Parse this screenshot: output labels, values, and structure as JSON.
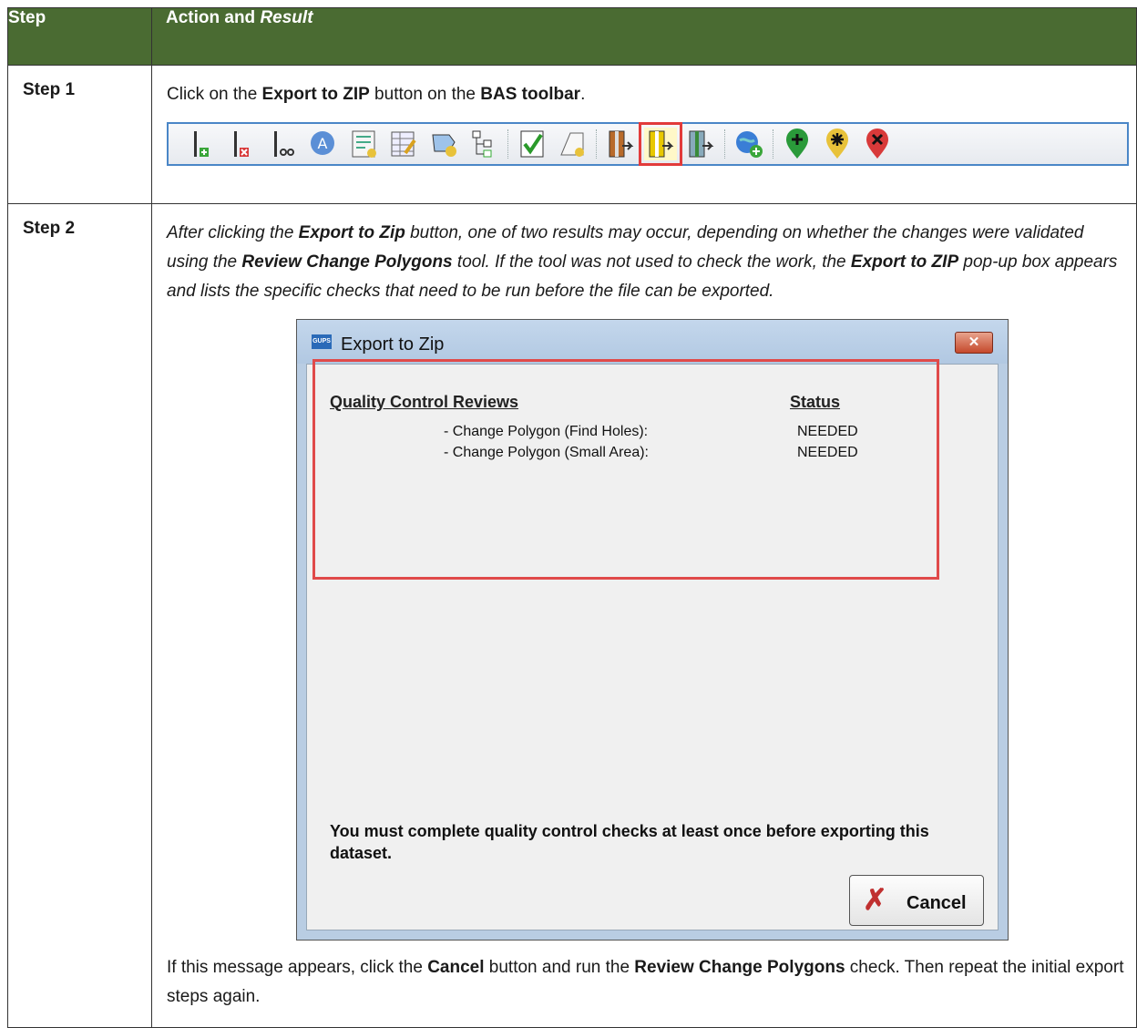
{
  "header": {
    "col1": "Step",
    "col2_prefix": "Action and ",
    "col2_italic": "Result"
  },
  "step1": {
    "label": "Step 1",
    "text_a": "Click on the ",
    "text_b": "Export to ZIP",
    "text_c": " button on the ",
    "text_d": "BAS toolbar",
    "text_e": "."
  },
  "toolbar": {
    "icons": [
      "add-line-icon",
      "delete-line-icon",
      "split-line-icon",
      "label-icon",
      "form-icon",
      "table-edit-icon",
      "landmark-icon",
      "hierarchy-icon",
      "validate-icon",
      "review-polygons-icon",
      "import-zip-icon",
      "export-zip-icon",
      "export-map-icon",
      "add-layer-icon",
      "add-point-icon",
      "modify-point-icon",
      "delete-point-icon"
    ]
  },
  "step2": {
    "label": "Step 2",
    "p1": "After clicking the ",
    "p2": "Export to Zip",
    "p3": " button, one of two results may occur, depending on whether the changes were validated using the ",
    "p4": "Review Change Polygons",
    "p5": " tool. If the tool was not used to check the work, the ",
    "p6": "Export to ZIP",
    "p7": " pop-up box appears and lists the specific checks that need to be run before the file can be exported.",
    "after_a": "If this message appears, click the ",
    "after_b": "Cancel",
    "after_c": " button and run the ",
    "after_d": "Review Change Polygons",
    "after_e": " check. Then repeat the initial export steps again."
  },
  "dialog": {
    "logo": "GUPS",
    "title": "Export to Zip",
    "close": "✕",
    "qc_header": "Quality Control Reviews",
    "status_header": "Status",
    "checks": [
      {
        "name": "- Change Polygon (Find Holes):",
        "status": "NEEDED"
      },
      {
        "name": "- Change Polygon (Small Area):",
        "status": "NEEDED"
      }
    ],
    "message": "You must complete quality control checks at least once before exporting this dataset.",
    "cancel_label": "Cancel",
    "cancel_icon": "✗"
  },
  "colors": {
    "header_bg": "#4a6b32",
    "highlight": "#e04a4a",
    "toolbar_border": "#4a86c7"
  }
}
